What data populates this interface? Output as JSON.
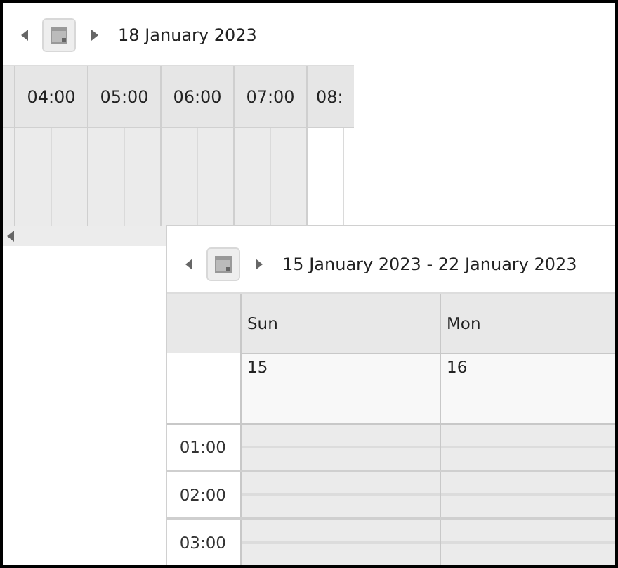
{
  "day_view": {
    "title": "18 January 2023",
    "hours": [
      {
        "label": "04:00",
        "working": false
      },
      {
        "label": "05:00",
        "working": false
      },
      {
        "label": "06:00",
        "working": false
      },
      {
        "label": "07:00",
        "working": false
      },
      {
        "label": "08:",
        "working": true
      }
    ]
  },
  "week_view": {
    "title": "15 January 2023 - 22 January 2023",
    "days": [
      {
        "name": "Sun",
        "date": "15"
      },
      {
        "name": "Mon",
        "date": "16"
      }
    ],
    "times": [
      "01:00",
      "02:00",
      "03:00"
    ]
  }
}
